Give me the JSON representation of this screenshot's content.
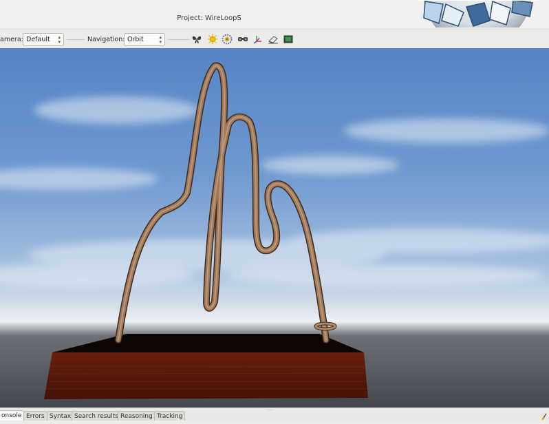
{
  "window": {
    "title": "Project: WireLoopS"
  },
  "toolbar": {
    "camera_label": "amera:",
    "camera_value": "Default",
    "navigation_label": "Navigation:",
    "navigation_value": "Orbit",
    "icons": [
      "butterfly-icon",
      "sun-icon",
      "gear-sun-icon",
      "binoculars-icon",
      "axes-icon",
      "eraser-icon",
      "screen-icon"
    ]
  },
  "bottom_tabs": [
    "onsole",
    "Errors",
    "Syntax",
    "Search results",
    "Reasoning",
    "Tracking"
  ],
  "colors": {
    "sky_top": "#4f7fc4",
    "sky_horizon": "#c8d6e6",
    "ground": "#4e5057",
    "wire": "#a07a5a",
    "base_side": "#5a1a0a",
    "base_top": "#120807"
  }
}
